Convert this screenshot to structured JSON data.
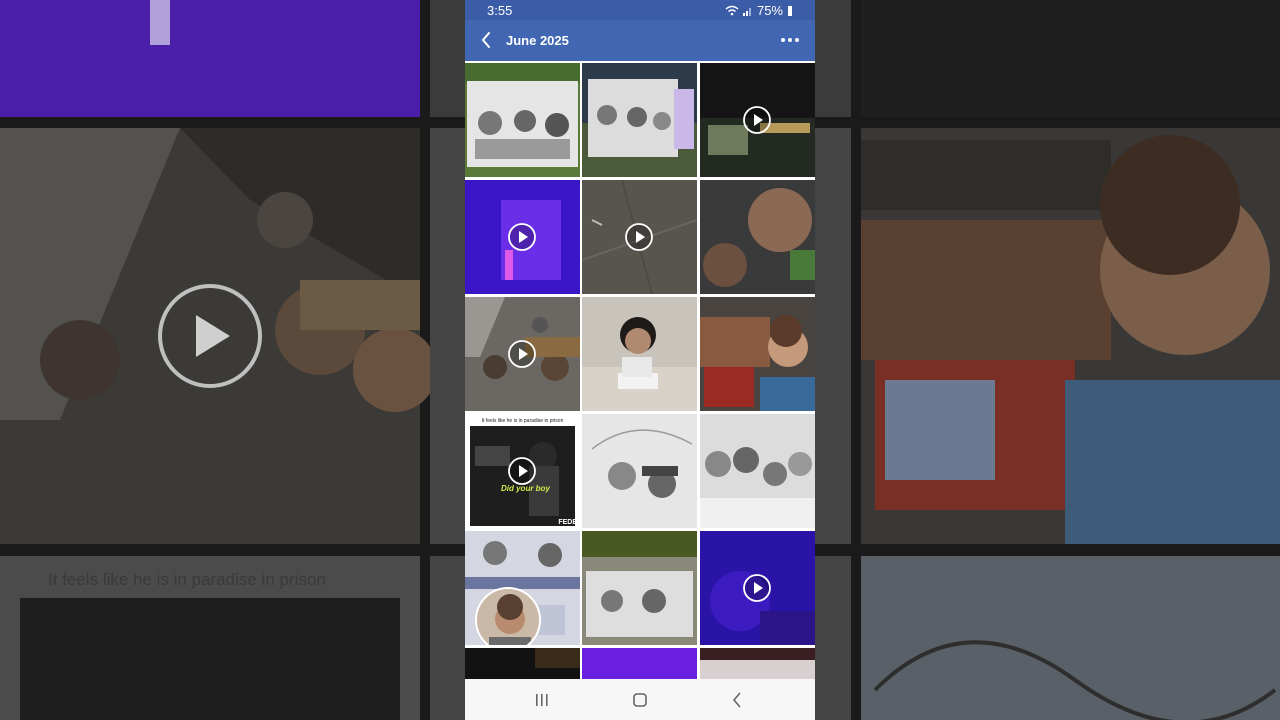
{
  "status": {
    "time": "3:55",
    "battery": "75%",
    "icons": [
      "wifi-icon",
      "signal-icon",
      "battery-icon"
    ]
  },
  "appbar": {
    "title": "June 2025",
    "back_icon": "chevron-left-icon",
    "more_icon": "more-horizontal-icon"
  },
  "colors": {
    "statusbar": "#3b5da8",
    "appbar": "#4267b2",
    "navbar": "#f7f7f7"
  },
  "grid": {
    "tiles": [
      {
        "kind": "sketch-photo",
        "video": false
      },
      {
        "kind": "sketch-photo",
        "video": false
      },
      {
        "kind": "night-street",
        "video": true
      },
      {
        "kind": "purple-light",
        "video": true
      },
      {
        "kind": "pavement",
        "video": true
      },
      {
        "kind": "selfie-upside-down",
        "video": false
      },
      {
        "kind": "group-selfie",
        "video": true
      },
      {
        "kind": "woman-holding-paper",
        "video": false
      },
      {
        "kind": "supermarket-selfie",
        "video": false
      },
      {
        "kind": "meme",
        "video": true
      },
      {
        "kind": "sketch-umbrella",
        "video": false
      },
      {
        "kind": "sketch-group",
        "video": false
      },
      {
        "kind": "sketch-with-avatar",
        "video": false
      },
      {
        "kind": "sketch-photo",
        "video": false
      },
      {
        "kind": "purple-blur",
        "video": true
      }
    ],
    "meme": {
      "caption": "It feels like he is in paradise in prison",
      "subtitle": "Did your boy",
      "brand": "FEDE"
    }
  },
  "background": {
    "caption": "It feels like he is in paradise in prison"
  },
  "navbar": {
    "items": [
      "recent-apps-icon",
      "home-icon",
      "back-icon"
    ]
  }
}
